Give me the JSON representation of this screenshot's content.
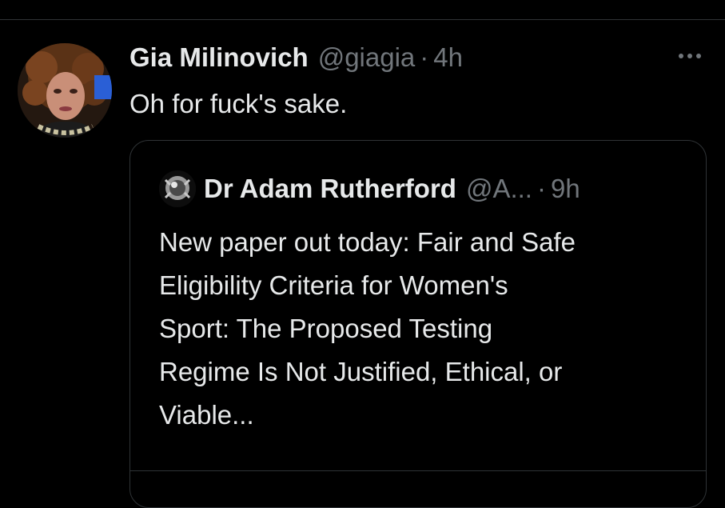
{
  "tweet": {
    "display_name": "Gia Milinovich",
    "handle": "@giagia",
    "separator": "·",
    "time": "4h",
    "text": "Oh for fuck's sake.",
    "more_icon": "more-horizontal-icon"
  },
  "quoted_tweet": {
    "display_name": "Dr Adam Rutherford",
    "handle": "@A...",
    "separator": "·",
    "time": "9h",
    "text_lines": [
      "New paper out today: Fair and Safe",
      "Eligibility Criteria for Women's",
      "Sport: The Proposed Testing",
      "Regime Is Not Justified, Ethical, or",
      "Viable..."
    ]
  },
  "colors": {
    "background": "#000000",
    "primary_text": "#e7e9ea",
    "secondary_text": "#71767b",
    "border": "#2f3336"
  }
}
